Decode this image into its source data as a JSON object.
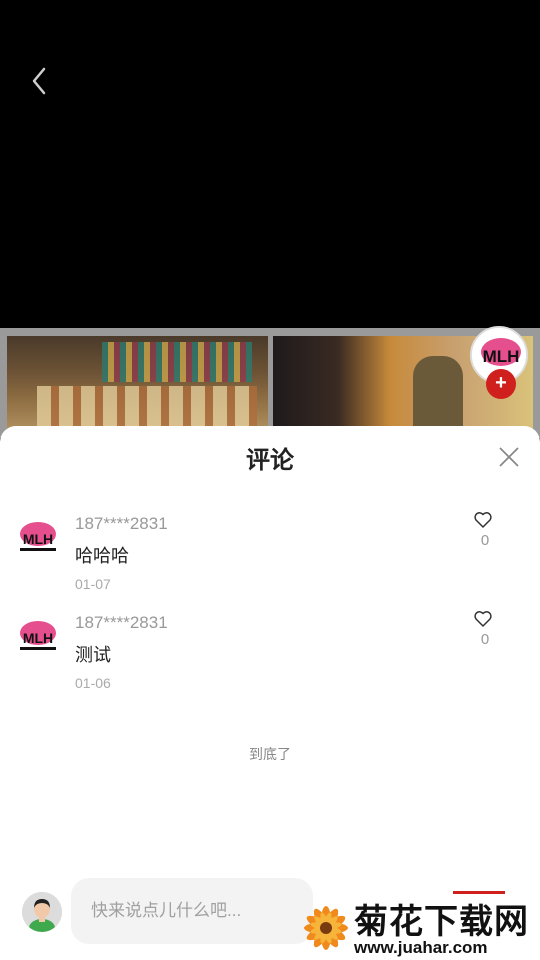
{
  "status_bar": {
    "icons": [
      "app-notification-icon",
      "app-notification-icon",
      "app-notification-icon",
      "heart-app-icon"
    ]
  },
  "video": {
    "back_icon": "chevron-left-icon"
  },
  "gallery": {
    "creator_logo_text": "MLH",
    "follow_label": "+"
  },
  "comments_sheet": {
    "title": "评论",
    "close_icon": "close-icon",
    "comments": [
      {
        "user": "187****2831",
        "text": "哈哈哈",
        "date": "01-07",
        "likes": "0"
      },
      {
        "user": "187****2831",
        "text": "测试",
        "date": "01-06",
        "likes": "0"
      }
    ],
    "end_text": "到底了"
  },
  "input_bar": {
    "placeholder": "快来说点儿什么吧..."
  },
  "watermark": {
    "title": "菊花下载网",
    "url": "www.juahar.com"
  },
  "colors": {
    "accent": "#d0201e",
    "status_icon": "#1fb5b8",
    "logo_pink": "#e0307a"
  }
}
